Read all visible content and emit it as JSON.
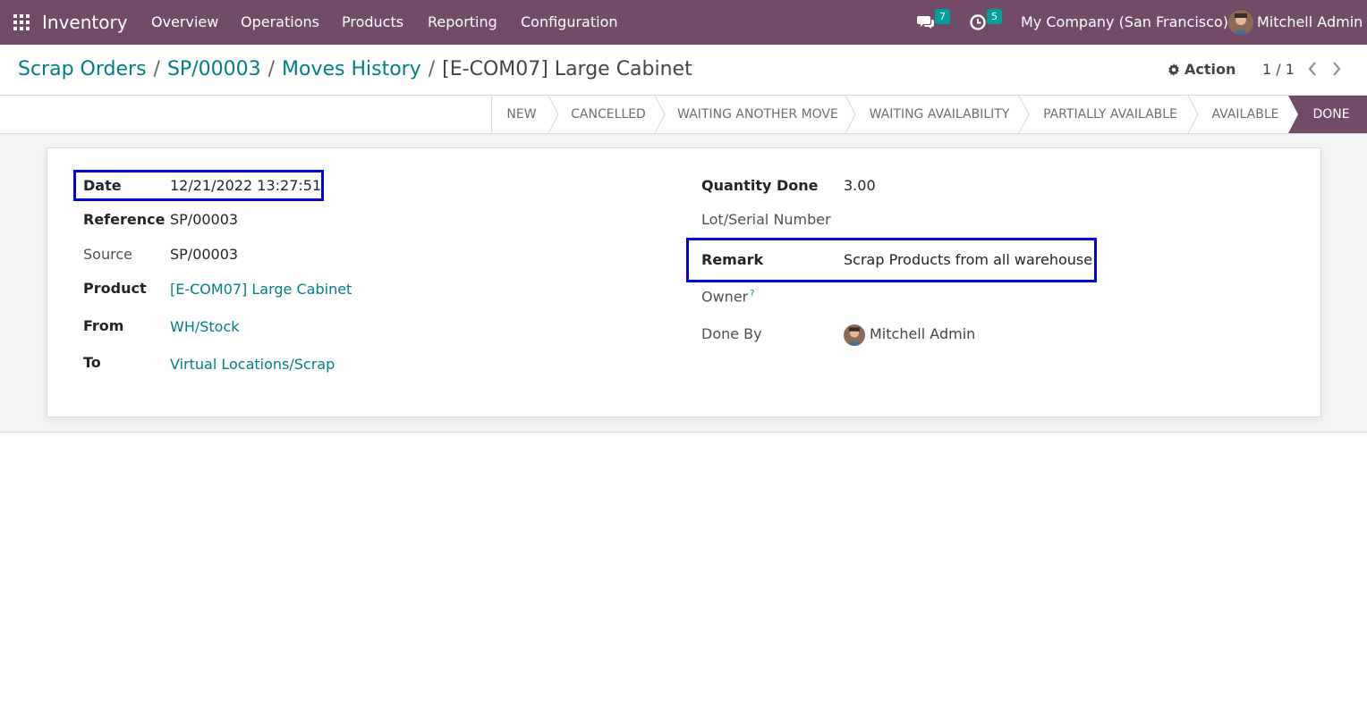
{
  "navbar": {
    "app_name": "Inventory",
    "menus": [
      "Overview",
      "Operations",
      "Products",
      "Reporting",
      "Configuration"
    ],
    "messages_count": "7",
    "activities_count": "5",
    "company": "My Company (San Francisco)",
    "user": "Mitchell Admin",
    "icons": [
      "apps-grid-icon",
      "chat-icon",
      "clock-icon",
      "avatar"
    ],
    "color": "#714b67"
  },
  "breadcrumbs": {
    "items": [
      "Scrap Orders",
      "SP/00003",
      "Moves History"
    ],
    "separator": "/",
    "current": "[E-COM07] Large Cabinet"
  },
  "control": {
    "action_label": "Action",
    "pager": "1 / 1"
  },
  "statusbar": {
    "states": [
      "NEW",
      "CANCELLED",
      "WAITING ANOTHER MOVE",
      "WAITING AVAILABILITY",
      "PARTIALLY AVAILABLE",
      "AVAILABLE",
      "DONE"
    ],
    "active": "DONE"
  },
  "form": {
    "left": [
      {
        "label": "Date",
        "value": "12/21/2022 13:27:51"
      },
      {
        "label": "Reference",
        "value": "SP/00003"
      },
      {
        "label": "Source",
        "value": "SP/00003"
      },
      {
        "label": "Product",
        "value": "[E-COM07] Large Cabinet"
      },
      {
        "label": "From",
        "value": "WH/Stock"
      },
      {
        "label": "To",
        "value": "Virtual Locations/Scrap"
      }
    ],
    "right": [
      {
        "label": "Quantity Done",
        "value": "3.00"
      },
      {
        "label": "Lot/Serial Number",
        "value": ""
      },
      {
        "label": "Remark",
        "value": "Scrap Products from all warehouse!"
      },
      {
        "label": "Owner",
        "value": "",
        "help": "?"
      },
      {
        "label": "Done By",
        "value": "Mitchell Admin"
      }
    ]
  },
  "colors": {
    "primary": "#714b67",
    "link": "#017e84",
    "badge": "#00a09d",
    "highlight_box": "#0000e0"
  }
}
